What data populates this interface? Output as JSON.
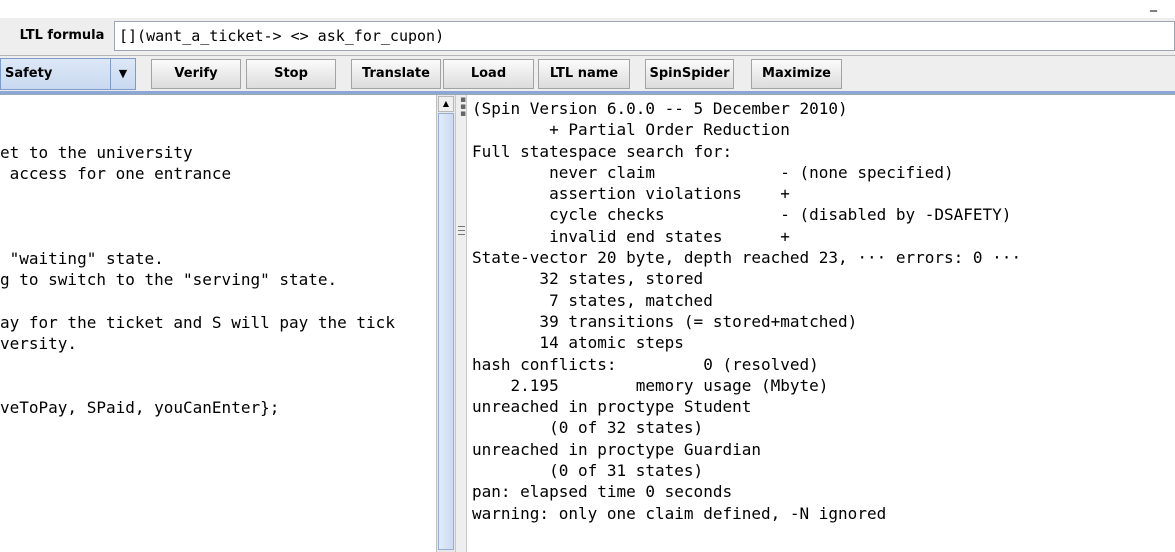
{
  "window": {
    "minimize_glyph": "_"
  },
  "ltl": {
    "label": "LTL formula",
    "formula": "[](want_a_ticket-> <> ask_for_cupon)"
  },
  "toolbar": {
    "mode_select": "Safety",
    "buttons": [
      "Verify",
      "Stop",
      "Translate",
      "Load",
      "LTL name",
      "SpinSpider",
      "Maximize"
    ]
  },
  "left_pane": {
    "lines": [
      "",
      "",
      "et to the university",
      " access for one entrance",
      "",
      "",
      "",
      " \"waiting\" state.",
      "g to switch to the \"serving\" state.",
      "",
      "ay for the ticket and S will pay the tick",
      "versity.",
      "",
      "",
      "veToPay, SPaid, youCanEnter};"
    ]
  },
  "right_pane": {
    "lines": [
      "(Spin Version 6.0.0 -- 5 December 2010)",
      "        + Partial Order Reduction",
      "Full statespace search for:",
      "        never claim             - (none specified)",
      "        assertion violations    +",
      "        cycle checks            - (disabled by -DSAFETY)",
      "        invalid end states      +",
      "State-vector 20 byte, depth reached 23, ··· errors: 0 ···",
      "       32 states, stored",
      "        7 states, matched",
      "       39 transitions (= stored+matched)",
      "       14 atomic steps",
      "hash conflicts:         0 (resolved)",
      "    2.195        memory usage (Mbyte)",
      "unreached in proctype Student",
      "        (0 of 32 states)",
      "unreached in proctype Guardian",
      "        (0 of 31 states)",
      "pan: elapsed time 0 seconds",
      "warning: only one claim defined, -N ignored"
    ]
  }
}
